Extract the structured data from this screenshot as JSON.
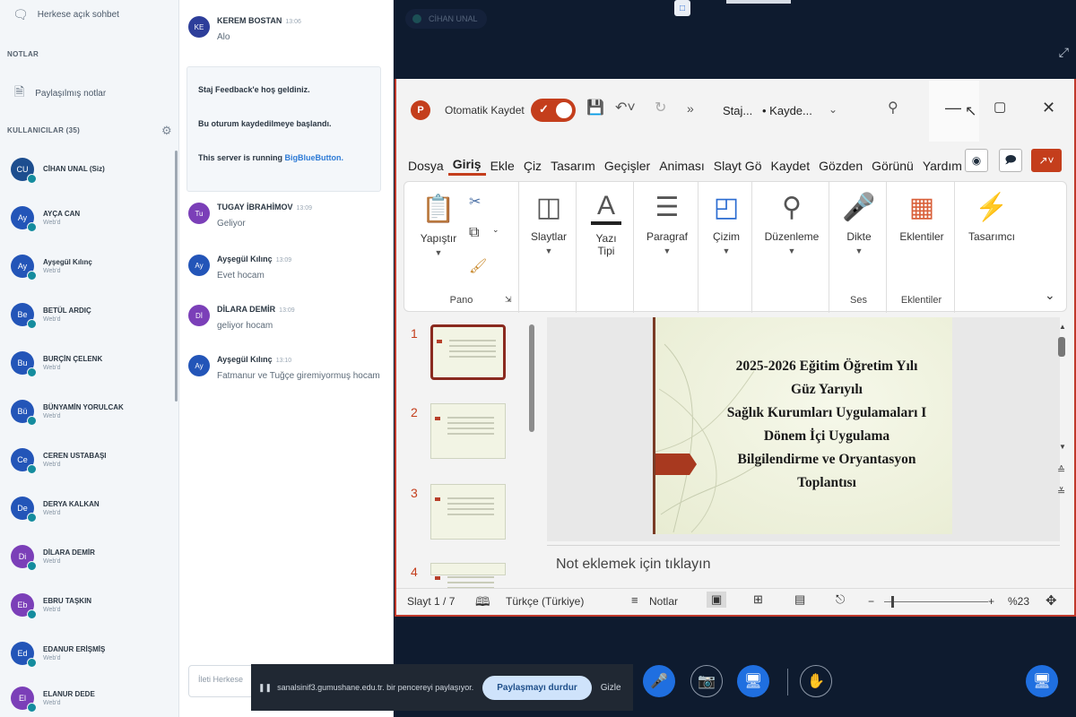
{
  "sidebar": {
    "public_chat": "Herkese açık sohbet",
    "notes_section": "NOTLAR",
    "shared_notes": "Paylaşılmış notlar",
    "users_section": "KULLANICILAR (35)",
    "users": [
      {
        "initials": "CU",
        "name": "CİHAN UNAL (Siz)",
        "role": "",
        "color": "#1d4e8f"
      },
      {
        "initials": "Ay",
        "name": "AYÇA CAN",
        "role": "Web'd",
        "color": "#2355b8"
      },
      {
        "initials": "Ay",
        "name": "Ayşegül Kılınç",
        "role": "Web'd",
        "color": "#2355b8"
      },
      {
        "initials": "Be",
        "name": "BETÜL ARDIÇ",
        "role": "Web'd",
        "color": "#2355b8"
      },
      {
        "initials": "Bu",
        "name": "BURÇİN ÇELENK",
        "role": "Web'd",
        "color": "#2355b8"
      },
      {
        "initials": "Bü",
        "name": "BÜNYAMİN YORULCAK",
        "role": "Web'd",
        "color": "#2355b8"
      },
      {
        "initials": "Ce",
        "name": "CEREN USTABAŞI",
        "role": "Web'd",
        "color": "#2355b8"
      },
      {
        "initials": "De",
        "name": "DERYA KALKAN",
        "role": "Web'd",
        "color": "#2355b8"
      },
      {
        "initials": "Di",
        "name": "DİLARA DEMİR",
        "role": "Web'd",
        "color": "#7b3fb8"
      },
      {
        "initials": "Eb",
        "name": "EBRU TAŞKIN",
        "role": "Web'd",
        "color": "#7b3fb8"
      },
      {
        "initials": "Ed",
        "name": "EDANUR ERİŞMİŞ",
        "role": "Web'd",
        "color": "#2355b8"
      },
      {
        "initials": "El",
        "name": "ELANUR DEDE",
        "role": "Web'd",
        "color": "#7b3fb8"
      }
    ]
  },
  "chat": {
    "messages": [
      {
        "initials": "KE",
        "name": "KEREM BOSTAN",
        "time": "13:06",
        "text": "Alo",
        "color": "#2d3e9a"
      },
      {
        "initials": "Tu",
        "name": "TUGAY İBRAHİMOV",
        "time": "13:09",
        "text": "Geliyor",
        "color": "#7b3fb8"
      },
      {
        "initials": "Ay",
        "name": "Ayşegül Kılınç",
        "time": "13:09",
        "text": "Evet hocam",
        "color": "#2355b8"
      },
      {
        "initials": "Dİ",
        "name": "DİLARA DEMİR",
        "time": "13:09",
        "text": "geliyor hocam",
        "color": "#7b3fb8"
      },
      {
        "initials": "Ay",
        "name": "Ayşegül Kılınç",
        "time": "13:10",
        "text": "Fatmanur ve Tuğçe giremiyormuş hocam",
        "color": "#2355b8"
      }
    ],
    "welcome_1": "Staj Feedback'e hoş geldiniz.",
    "welcome_2": "Bu oturum kaydedilmeye başlandı.",
    "welcome_3_prefix": "This server is running ",
    "welcome_3_link": "BigBlueButton.",
    "input_placeholder": "İleti Herkese"
  },
  "presentation": {
    "presenter": "CİHAN UNAL",
    "ppt": {
      "autosave_label": "Otomatik Kaydet",
      "doc_title": "Staj...",
      "doc_status": "• Kayde...",
      "tabs": [
        "Dosya",
        "Giriş",
        "Ekle",
        "Çiz",
        "Tasarım",
        "Geçişler",
        "Animası",
        "Slayt Gö",
        "Kaydet",
        "Gözden",
        "Görünü",
        "Yardım"
      ],
      "ribbon": {
        "paste": "Yapıştır",
        "clipboard_group": "Pano",
        "slides": "Slaytlar",
        "font_line1": "Yazı",
        "font_line2": "Tipi",
        "paragraph": "Paragraf",
        "drawing": "Çizim",
        "editing": "Düzenleme",
        "dictate": "Dikte",
        "voice_group": "Ses",
        "addins": "Eklentiler",
        "addins_group": "Eklentiler",
        "designer": "Tasarımcı"
      },
      "thumb_numbers": [
        "1",
        "2",
        "3",
        "4"
      ],
      "slide_lines": [
        "2025-2026 Eğitim Öğretim Yılı",
        "Güz Yarıyılı",
        "Sağlık Kurumları Uygulamaları I",
        "Dönem İçi Uygulama",
        "Bilgilendirme ve Oryantasyon",
        "Toplantısı"
      ],
      "notes_placeholder": "Not eklemek için tıklayın",
      "status": {
        "slide_count": "Slayt 1 / 7",
        "language": "Türkçe (Türkiye)",
        "notes": "Notlar",
        "zoom": "%23"
      }
    }
  },
  "bottom": {
    "share_text": "sanalsinif3.gumushane.edu.tr. bir pencereyi paylaşıyor.",
    "stop_share": "Paylaşmayı durdur",
    "hide": "Gizle"
  }
}
